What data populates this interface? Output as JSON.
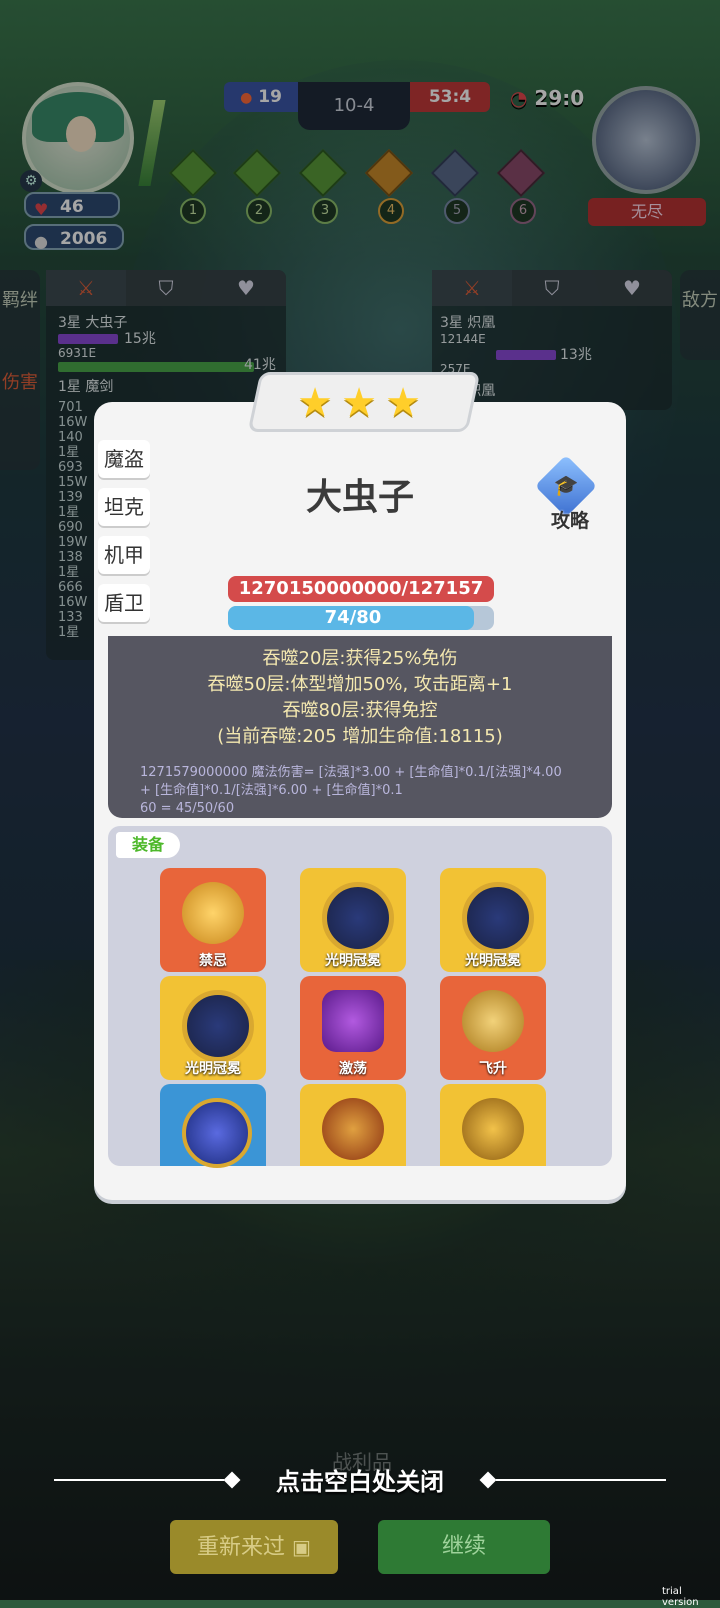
{
  "hud": {
    "hearts": "46",
    "coins": "2006",
    "my_score": "19",
    "stage": "10-4",
    "enemy_score": "53:4",
    "timer": "29:0",
    "enemy_mode": "无尽",
    "path_nodes": [
      "1",
      "2",
      "3",
      "4",
      "5",
      "6"
    ]
  },
  "side": {
    "left_tab_1": "羁绊",
    "left_tab_2": "伤害",
    "right_tab": "敌方"
  },
  "left_panel": {
    "rows": [
      {
        "name": "3星 大虫子",
        "value": "6931E",
        "value2": "15兆"
      },
      {
        "name": "",
        "value": "",
        "value2": "41兆"
      },
      {
        "name": "1星 魔剑",
        "value": "",
        "value2": ""
      }
    ],
    "stats": [
      "701",
      "16W",
      "140",
      "1星",
      "693",
      "15W",
      "139",
      "1星",
      "690",
      "19W",
      "138",
      "1星",
      "666",
      "16W",
      "133",
      "1星"
    ]
  },
  "right_panel": {
    "rows": [
      {
        "name": "3星 炽凰",
        "value": "12144E",
        "value2": "13兆"
      },
      {
        "name": "1星 炽凰",
        "value": "257E",
        "value2": ""
      }
    ]
  },
  "modal": {
    "stars": 3,
    "categories": [
      "魔盗",
      "坦克",
      "机甲",
      "盾卫"
    ],
    "title": "大虫子",
    "strategy_label": "攻略",
    "hp_text": "1270150000000/127157",
    "mana_text": "74/80",
    "mana_fraction": 0.925,
    "desc_lines": [
      "吞噬20层:获得25%免伤",
      "吞噬50层:体型增加50%, 攻击距离+1",
      "吞噬80层:获得免控",
      "(当前吞噬:205 增加生命值:18115)"
    ],
    "formula_line1": "1271579000000 魔法伤害= [法强]*3.00 + [生命值]*0.1/[法强]*4.00",
    "formula_line2": "+ [生命值]*0.1/[法强]*6.00 + [生命值]*0.1",
    "formula_line3": "60 = 45/50/60",
    "equip_label": "装备",
    "items": [
      {
        "label": "禁忌",
        "bg": "#e8653a"
      },
      {
        "label": "光明冠冕",
        "bg": "#f2c234"
      },
      {
        "label": "光明冠冕",
        "bg": "#f2c234"
      },
      {
        "label": "光明冠冕",
        "bg": "#f2c234"
      },
      {
        "label": "激荡",
        "bg": "#e8653a"
      },
      {
        "label": "飞升",
        "bg": "#e8653a"
      },
      {
        "label": "",
        "bg": "#3b95d6"
      },
      {
        "label": "",
        "bg": "#f2c234"
      },
      {
        "label": "",
        "bg": "#f2c234"
      }
    ]
  },
  "footer": {
    "close_hint": "点击空白处关闭",
    "spoils": "战利品",
    "retry": "重新来过",
    "continue": "继续",
    "trial": "trial version"
  }
}
